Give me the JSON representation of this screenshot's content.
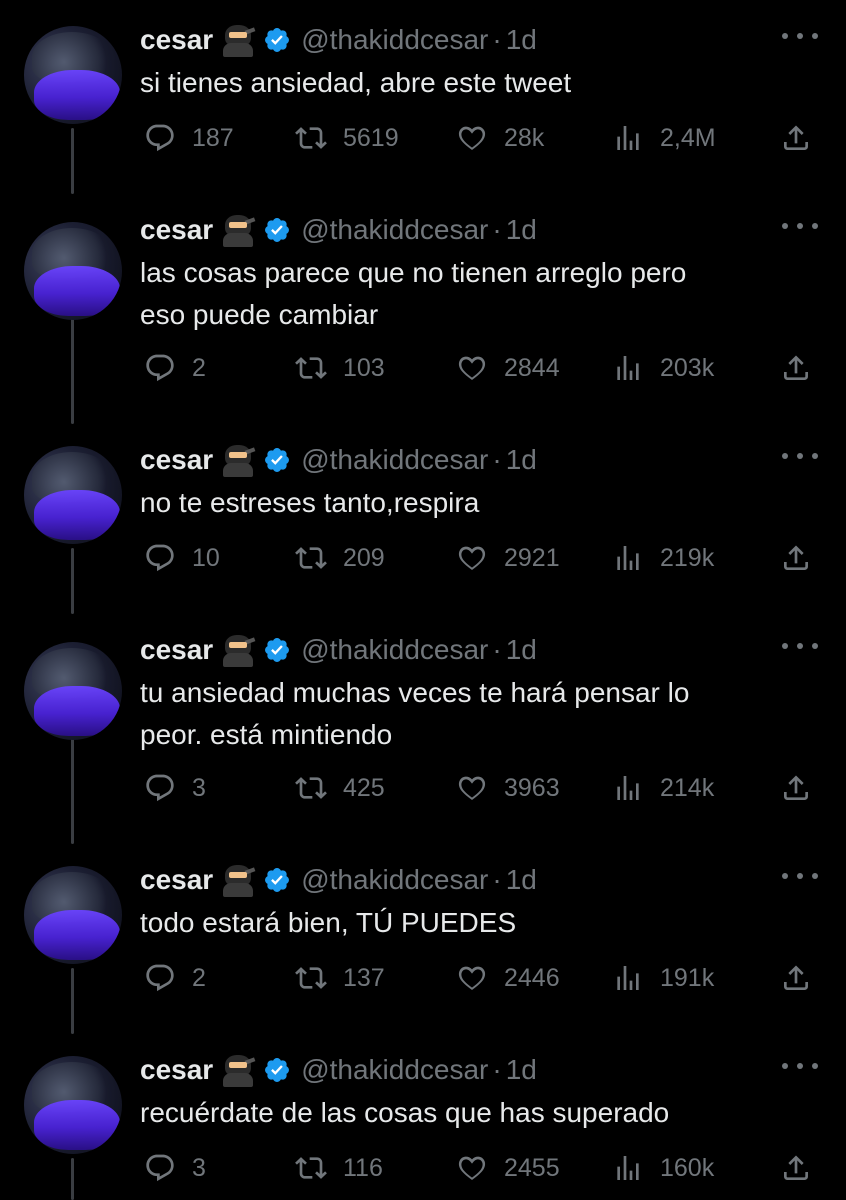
{
  "tweets": [
    {
      "name": "cesar",
      "handle": "@thakiddcesar",
      "separator": "·",
      "time": "1d",
      "lines": [
        "si tienes ansiedad, abre este tweet"
      ],
      "replies": "187",
      "retweets": "5619",
      "likes": "28k",
      "views": "2,4M"
    },
    {
      "name": "cesar",
      "handle": "@thakiddcesar",
      "separator": "·",
      "time": "1d",
      "lines": [
        "las cosas parece que no tienen arreglo pero",
        "eso puede cambiar"
      ],
      "replies": "2",
      "retweets": "103",
      "likes": "2844",
      "views": "203k"
    },
    {
      "name": "cesar",
      "handle": "@thakiddcesar",
      "separator": "·",
      "time": "1d",
      "lines": [
        "no te estreses tanto,respira"
      ],
      "replies": "10",
      "retweets": "209",
      "likes": "2921",
      "views": "219k"
    },
    {
      "name": "cesar",
      "handle": "@thakiddcesar",
      "separator": "·",
      "time": "1d",
      "lines": [
        "tu ansiedad muchas veces te hará pensar lo",
        "peor. está mintiendo"
      ],
      "replies": "3",
      "retweets": "425",
      "likes": "3963",
      "views": "214k"
    },
    {
      "name": "cesar",
      "handle": "@thakiddcesar",
      "separator": "·",
      "time": "1d",
      "lines": [
        "todo estará bien, TÚ PUEDES"
      ],
      "replies": "2",
      "retweets": "137",
      "likes": "2446",
      "views": "191k"
    },
    {
      "name": "cesar",
      "handle": "@thakiddcesar",
      "separator": "·",
      "time": "1d",
      "lines": [
        "recuérdate de las cosas que has superado"
      ],
      "replies": "3",
      "retweets": "116",
      "likes": "2455",
      "views": "160k"
    }
  ],
  "icons": {
    "name_emoji": "ninja-icon",
    "verified": "verified-badge-icon",
    "more": "more-options-icon",
    "reply": "reply-icon",
    "retweet": "retweet-icon",
    "like": "like-icon",
    "views": "views-icon",
    "share": "share-icon"
  },
  "colors": {
    "background": "#000000",
    "text": "#e7e9ea",
    "secondary": "#71767b",
    "verified": "#1d9bf0",
    "thread_line": "#3a3d42"
  }
}
